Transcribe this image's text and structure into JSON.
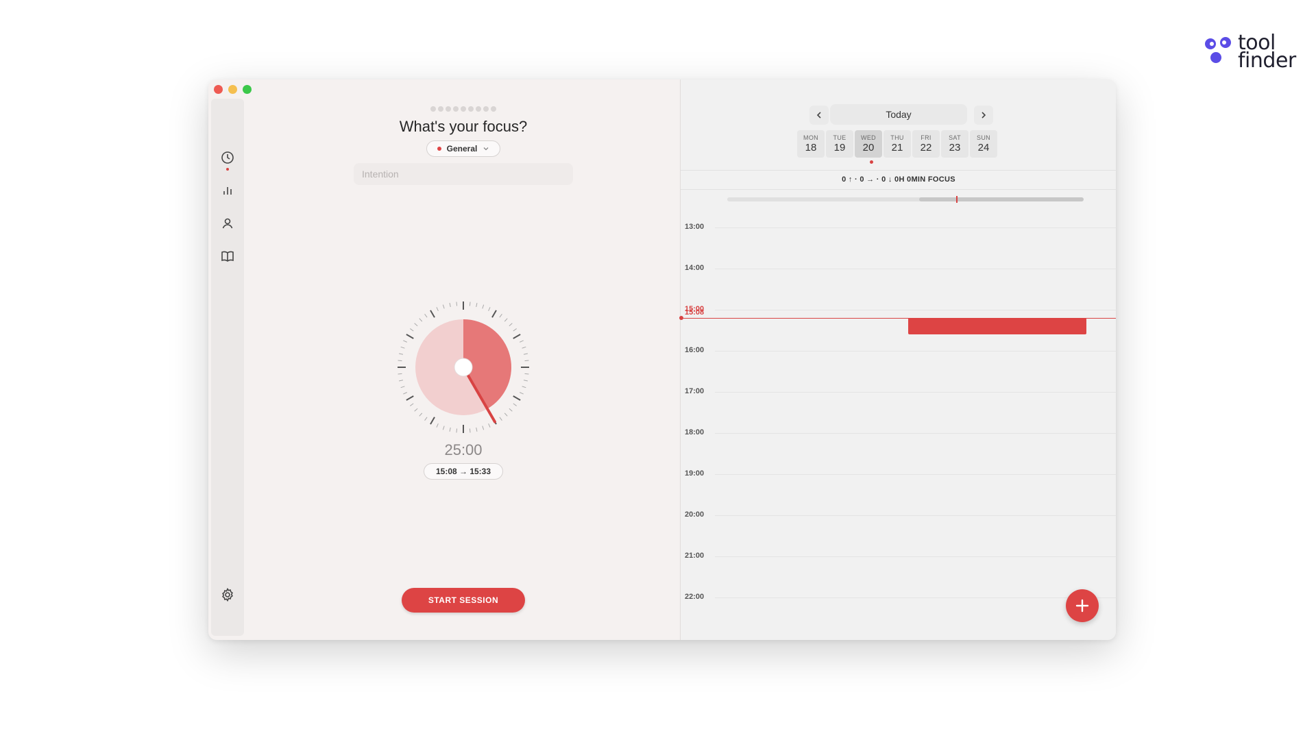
{
  "brand": {
    "line1": "tool",
    "line2": "finder"
  },
  "colors": {
    "accent": "#dd4444",
    "brand_purple": "#5b4de6",
    "background": "#f5f1f0"
  },
  "sidebar": {
    "items": [
      {
        "name": "timer",
        "icon": "clock-icon",
        "active": true
      },
      {
        "name": "stats",
        "icon": "bar-chart-icon"
      },
      {
        "name": "profile",
        "icon": "person-icon"
      },
      {
        "name": "library",
        "icon": "book-icon"
      }
    ],
    "settings_icon": "gear-icon"
  },
  "focus": {
    "title": "What's your focus?",
    "category": "General",
    "intention_placeholder": "Intention",
    "timer": "25:00",
    "range": "15:08 → 15:33",
    "start_label": "START SESSION",
    "progress_fraction": 0.4167
  },
  "calendar": {
    "today_label": "Today",
    "days": [
      {
        "name": "MON",
        "num": "18"
      },
      {
        "name": "TUE",
        "num": "19"
      },
      {
        "name": "WED",
        "num": "20"
      },
      {
        "name": "THU",
        "num": "21"
      },
      {
        "name": "FRI",
        "num": "22"
      },
      {
        "name": "SAT",
        "num": "23"
      },
      {
        "name": "SUN",
        "num": "24"
      }
    ],
    "selected_day": "WED",
    "summary": "0 ↑ · 0 → · 0 ↓   0H 0MIN FOCUS",
    "hours": [
      "13:00",
      "14:00",
      "15:00",
      "16:00",
      "17:00",
      "18:00",
      "19:00",
      "20:00",
      "21:00",
      "22:00"
    ],
    "now_label": "15:08"
  }
}
